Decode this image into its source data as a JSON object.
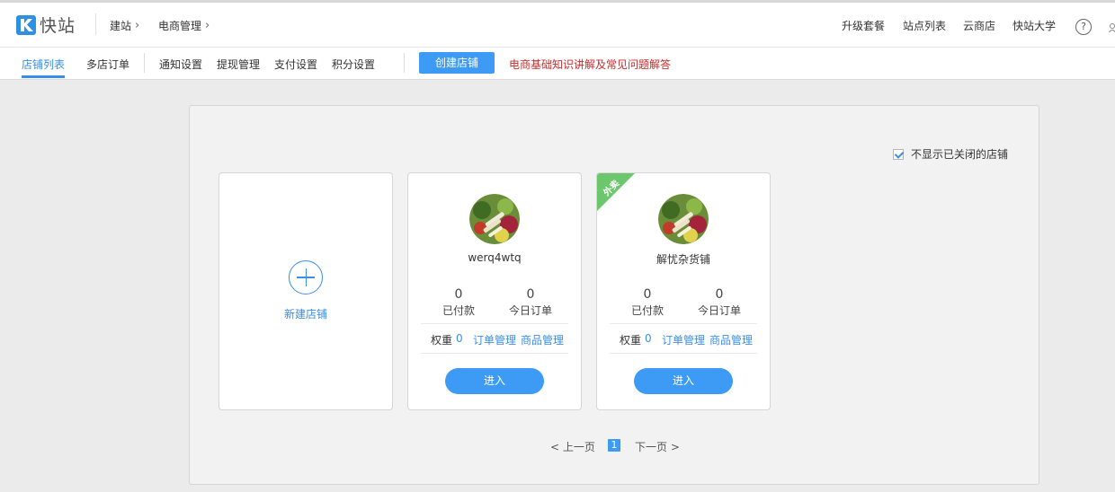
{
  "header": {
    "logo_text": "快站",
    "breadcrumb": [
      {
        "label": "建站"
      },
      {
        "label": "电商管理"
      }
    ],
    "right_links": [
      "升级套餐",
      "站点列表",
      "云商店",
      "快站大学"
    ],
    "help_glyph": "?"
  },
  "subnav": {
    "tabs": [
      "店铺列表",
      "多店订单",
      "通知设置",
      "提现管理",
      "支付设置",
      "积分设置"
    ],
    "create_button": "创建店铺",
    "help_link": "电商基础知识讲解及常见问题解答"
  },
  "panel": {
    "hide_closed_label": "不显示已关闭的店铺",
    "hide_closed_checked": true,
    "new_store_label": "新建店铺",
    "stores": [
      {
        "name": "werq4wtq",
        "paid": "0",
        "paid_label": "已付款",
        "today_orders": "0",
        "today_label": "今日订单",
        "weight_label": "权重",
        "weight": "0",
        "order_link": "订单管理",
        "goods_link": "商品管理",
        "enter_label": "进入",
        "badge": ""
      },
      {
        "name": "解忧杂货铺",
        "paid": "0",
        "paid_label": "已付款",
        "today_orders": "0",
        "today_label": "今日订单",
        "weight_label": "权重",
        "weight": "0",
        "order_link": "订单管理",
        "goods_link": "商品管理",
        "enter_label": "进入",
        "badge": "外卖"
      }
    ],
    "pager": {
      "prev": "< 上一页",
      "current": "1",
      "next": "下一页 >"
    }
  },
  "colors": {
    "accent": "#3e9bf5",
    "link": "#3a8ee6",
    "warning_link": "#cc2a2a",
    "badge": "#6cc66c"
  }
}
